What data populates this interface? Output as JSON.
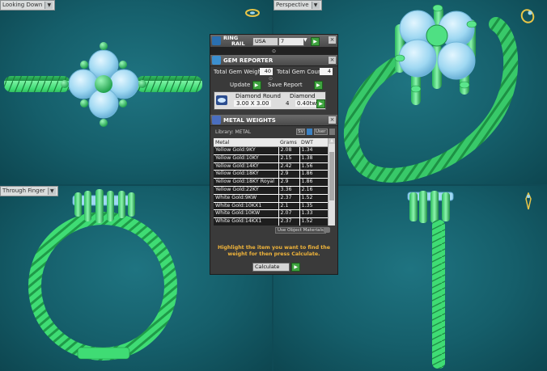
{
  "viewports": {
    "top_left": {
      "label": "Looking Down"
    },
    "top_right": {
      "label": "Perspective"
    },
    "bottom_left": {
      "label": "Through Finger"
    },
    "bottom_right": {
      "label": ""
    }
  },
  "ring_rail": {
    "title_line1": "RING",
    "title_line2": "RAIL",
    "country": "USA",
    "size": "7"
  },
  "gem_reporter": {
    "title": "GEM REPORTER",
    "total_weight_label": "Total Gem Weight",
    "total_weight_value": "40",
    "total_count_label": "Total Gem Count",
    "total_count_value": "4",
    "update_label": "Update",
    "save_report_label": "Save Report",
    "gem": {
      "shape": "Diamond Round",
      "size": "3.00 X 3.00",
      "material": "Diamond",
      "count": "4",
      "weight": "0.40tw"
    }
  },
  "metal_weights": {
    "title": "METAL WEIGHTS",
    "library_label": "Library: METAL",
    "sv_label": "SV",
    "user_label": "User",
    "columns": [
      "Metal",
      "Grams",
      "DWT"
    ],
    "rows": [
      [
        "Yellow Gold:9KY",
        "2.08",
        "1.34"
      ],
      [
        "Yellow Gold:10KY",
        "2.15",
        "1.38"
      ],
      [
        "Yellow Gold:14KY",
        "2.42",
        "1.56"
      ],
      [
        "Yellow Gold:18KY",
        "2.9",
        "1.86"
      ],
      [
        "Yellow Gold:18KY Royal",
        "2.9",
        "1.86"
      ],
      [
        "Yellow Gold:22KY",
        "3.36",
        "2.16"
      ],
      [
        "White Gold:9KW",
        "2.37",
        "1.52"
      ],
      [
        "White Gold:10KX1",
        "2.1",
        "1.35"
      ],
      [
        "White Gold:10KW",
        "2.07",
        "1.33"
      ],
      [
        "White Gold:14KX1",
        "2.37",
        "1.52"
      ],
      [
        "White Gold:14K PdW",
        "2.71",
        "1.74"
      ]
    ],
    "use_object_materials": "Use Object Materials",
    "instruction": "Highlight the item you want to find the weight for then press Calculate.",
    "calculate_label": "Calculate"
  },
  "colors": {
    "ring_green": "#3fe07a",
    "gem_blue": "#9fd8f2",
    "viewport_teal": "#1a6a76",
    "instruction_yellow": "#f0b43a"
  }
}
